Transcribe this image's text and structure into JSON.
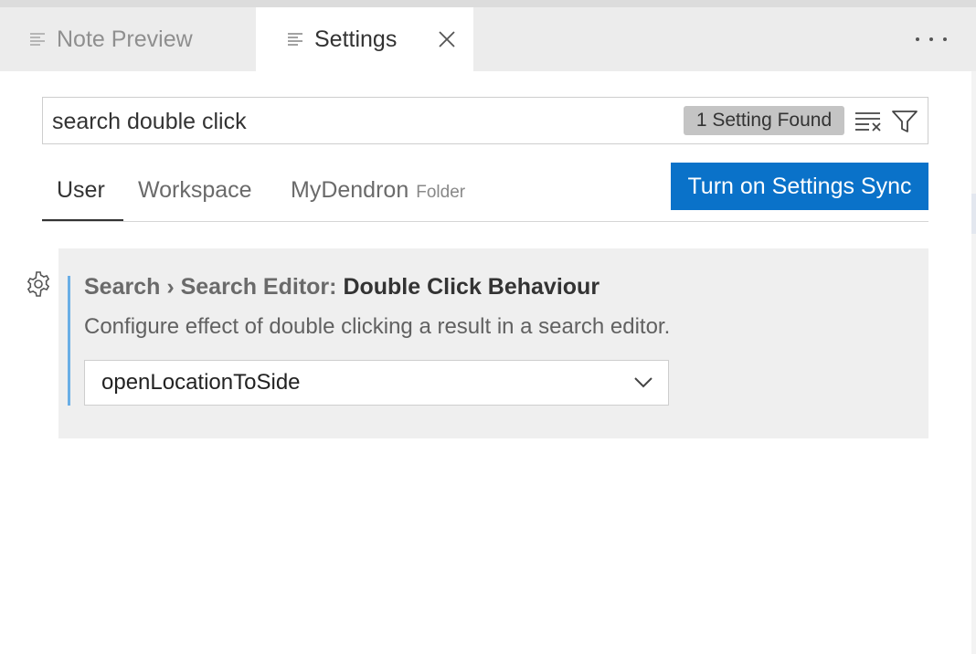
{
  "tabs": [
    {
      "label": "Note Preview",
      "active": false
    },
    {
      "label": "Settings",
      "active": true
    }
  ],
  "search": {
    "value": "search double click",
    "placeholder": "Search settings",
    "result_count": "1 Setting Found"
  },
  "scopes": {
    "user": "User",
    "workspace": "Workspace",
    "folder": "MyDendron",
    "folder_label": "Folder",
    "active": "User"
  },
  "sync_button": "Turn on Settings Sync",
  "setting": {
    "category": "Search › Search Editor: ",
    "key": "Double Click Behaviour",
    "description": "Configure effect of double clicking a result in a search editor.",
    "value": "openLocationToSide"
  },
  "colors": {
    "accent": "#0a72c9",
    "modified_indicator": "#6aaee6"
  },
  "icons": {
    "tab_file": "file-lines-icon",
    "tab_close": "close-icon",
    "more": "more-actions-icon",
    "clear": "clear-filter-icon",
    "filter": "filter-icon",
    "setting_gear": "gear-icon",
    "dropdown": "chevron-down-icon"
  }
}
